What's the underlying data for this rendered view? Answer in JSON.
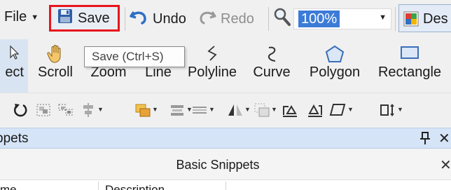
{
  "toolbar": {
    "file_label": "File",
    "save_label": "Save",
    "undo_label": "Undo",
    "redo_label": "Redo",
    "zoom_value": "100%",
    "design_label": "Des"
  },
  "tools": {
    "select_label": "ect",
    "scroll_label": "Scroll",
    "zoom_label": "Zoom",
    "line_label": "Line",
    "polyline_label": "Polyline",
    "curve_label": "Curve",
    "polygon_label": "Polygon",
    "rectangle_label": "Rectangle"
  },
  "tooltip": {
    "text": "Save (Ctrl+S)"
  },
  "pane": {
    "title": "ppets"
  },
  "document": {
    "title": "Basic Snippets"
  },
  "grid": {
    "columns": [
      "me",
      "Description"
    ]
  },
  "icons": {
    "file_caret": "chevron-down-icon",
    "save": "floppy-disk-icon",
    "undo": "undo-icon",
    "redo": "redo-icon",
    "zoom": "magnifier-icon",
    "design": "design-icon",
    "scroll": "hand-icon",
    "line": "line-tool-icon",
    "curve": "curve-tool-icon",
    "polygon": "polygon-icon",
    "rectangle": "rectangle-icon",
    "pin": "pin-icon",
    "close": "close-icon"
  },
  "colors": {
    "highlight_border": "#e8141c",
    "zoom_selection": "#3c7bd8",
    "pane_header": "#d5e4f6",
    "undo_blue": "#2f6fc4"
  }
}
